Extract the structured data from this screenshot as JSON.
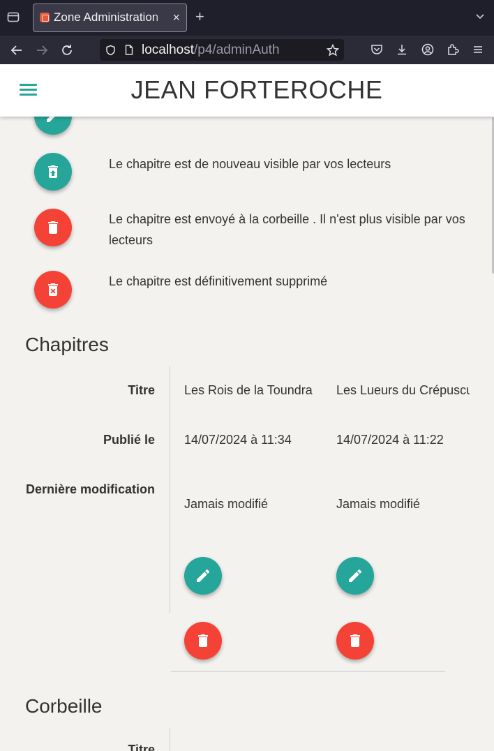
{
  "browser": {
    "tab_title": "Zone Administration",
    "tab_close": "×",
    "new_tab": "+",
    "url_host": "localhost",
    "url_path": "/p4/adminAuth"
  },
  "header": {
    "title": "JEAN FORTEROCHE"
  },
  "legend": [
    {
      "icon": "pencil-icon",
      "color": "#26a69a",
      "text": ""
    },
    {
      "icon": "restore-from-trash-icon",
      "color": "#26a69a",
      "text": "Le chapitre est de nouveau visible par vos lecteurs"
    },
    {
      "icon": "trash-icon",
      "color": "#f44336",
      "text": "Le chapitre est envoyé à la corbeille . Il n'est plus visible par vos lecteurs"
    },
    {
      "icon": "delete-forever-icon",
      "color": "#f44336",
      "text": "Le chapitre est définitivement supprimé"
    }
  ],
  "chapters": {
    "title": "Chapitres",
    "labels": {
      "title": "Titre",
      "published": "Publié le",
      "modified": "Dernière modification"
    },
    "items": [
      {
        "title": "Les Rois de la Toundra",
        "published": "14/07/2024 à 11:34",
        "modified": "Jamais modifié"
      },
      {
        "title": "Les Lueurs du Crépuscule",
        "published": "14/07/2024 à 11:22",
        "modified": "Jamais modifié"
      }
    ]
  },
  "trash": {
    "title": "Corbeille",
    "labels": {
      "title": "Titre"
    }
  },
  "colors": {
    "accent": "#26a69a",
    "danger": "#f44336",
    "background": "#f3f2ef"
  }
}
